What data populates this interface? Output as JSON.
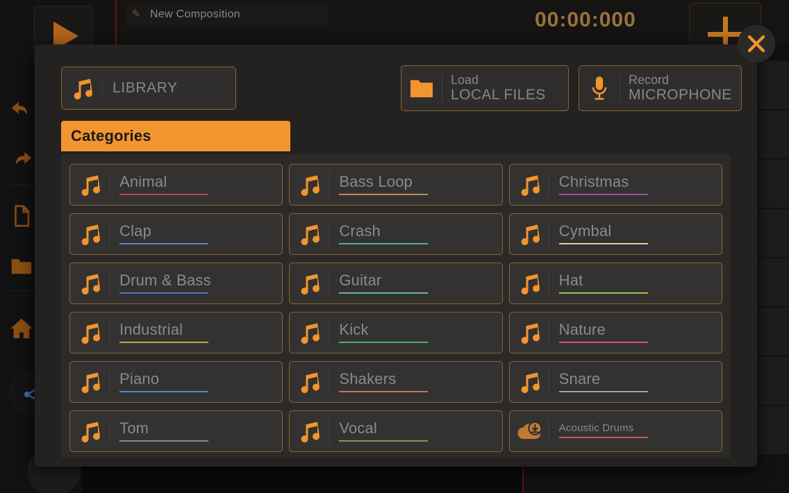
{
  "app": {
    "composition_title": "New Composition",
    "timecode": "00:00:000",
    "play_label": "play",
    "add_track_label": "+"
  },
  "rail": {
    "items": [
      {
        "name": "undo-icon",
        "label": "Undo"
      },
      {
        "name": "redo-icon",
        "label": "Redo"
      },
      {
        "name": "new-file-icon",
        "label": "New"
      },
      {
        "name": "open-folder-icon",
        "label": "Open"
      },
      {
        "name": "home-icon",
        "label": "Home"
      },
      {
        "name": "share-icon",
        "label": "Share"
      }
    ]
  },
  "modal": {
    "close_label": "✕",
    "library_tab": {
      "label": "LIBRARY",
      "icon": "music-note-icon"
    },
    "load_button": {
      "line1": "Load",
      "line2": "LOCAL FILES",
      "icon": "folder-icon"
    },
    "record_button": {
      "line1": "Record",
      "line2": "MICROPHONE",
      "icon": "microphone-icon"
    },
    "categories_tab": {
      "label": "Categories"
    },
    "categories": [
      {
        "label": "Animal",
        "icon": "music-note-icon",
        "accent": "#b8495c"
      },
      {
        "label": "Bass Loop",
        "icon": "music-note-icon",
        "accent": "#c08a5a"
      },
      {
        "label": "Christmas",
        "icon": "music-note-icon",
        "accent": "#9a4f9e"
      },
      {
        "label": "Clap",
        "icon": "music-note-icon",
        "accent": "#5b7fc4"
      },
      {
        "label": "Crash",
        "icon": "music-note-icon",
        "accent": "#52b08d"
      },
      {
        "label": "Cymbal",
        "icon": "music-note-icon",
        "accent": "#d8cfa6"
      },
      {
        "label": "Drum & Bass",
        "icon": "music-note-icon",
        "accent": "#5773b8"
      },
      {
        "label": "Guitar",
        "icon": "music-note-icon",
        "accent": "#63b6a8"
      },
      {
        "label": "Hat",
        "icon": "music-note-icon",
        "accent": "#a8c15e"
      },
      {
        "label": "Industrial",
        "icon": "music-note-icon",
        "accent": "#b5a84e"
      },
      {
        "label": "Kick",
        "icon": "music-note-icon",
        "accent": "#4fb178"
      },
      {
        "label": "Nature",
        "icon": "music-note-icon",
        "accent": "#d2557f"
      },
      {
        "label": "Piano",
        "icon": "music-note-icon",
        "accent": "#4a86c8"
      },
      {
        "label": "Shakers",
        "icon": "music-note-icon",
        "accent": "#c8706b"
      },
      {
        "label": "Snare",
        "icon": "music-note-icon",
        "accent": "#9aa3b0"
      },
      {
        "label": "Tom",
        "icon": "music-note-icon",
        "accent": "#8e8c8a"
      },
      {
        "label": "Vocal",
        "icon": "music-note-icon",
        "accent": "#8a9455"
      },
      {
        "label": "Acoustic Drums",
        "icon": "cloud-download-icon",
        "accent": "#c9566b",
        "small": true
      }
    ]
  },
  "colors": {
    "accent_orange": "#f2952f",
    "modal_bg": "#232221",
    "item_border": "#8e6331",
    "text_gray": "#8c8a88"
  }
}
